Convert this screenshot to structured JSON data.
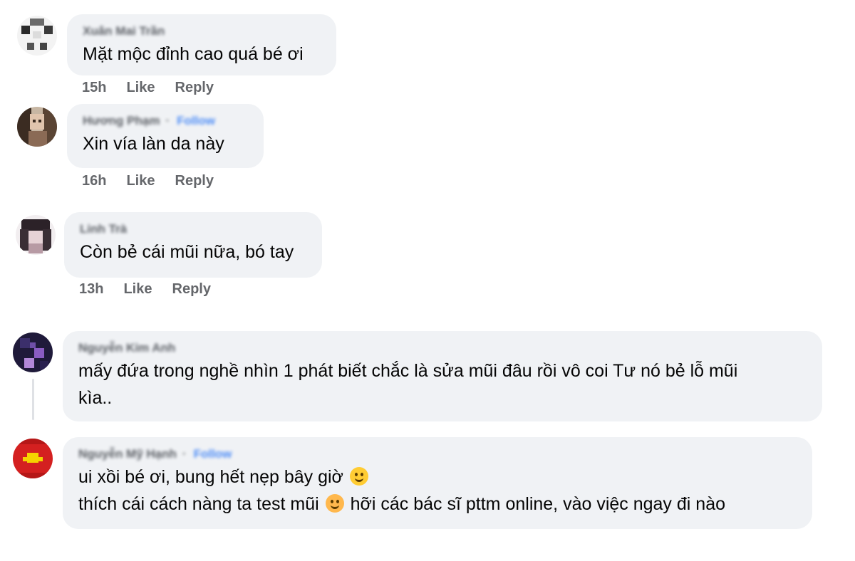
{
  "colors": {
    "bubble_bg": "#f0f2f5",
    "meta_text": "#65676b",
    "follow_blue": "#3b82f6"
  },
  "comments": [
    {
      "author": "Xuân Mai Trần",
      "follow": "",
      "text": "Mặt mộc đỉnh cao quá bé ơi",
      "time": "15h",
      "like": "Like",
      "reply": "Reply",
      "avatar_icon": "avatar-pixelated-icon"
    },
    {
      "author": "Hương Phạm",
      "follow": "Follow",
      "text": "Xin vía làn da này",
      "time": "16h",
      "like": "Like",
      "reply": "Reply",
      "avatar_icon": "avatar-pixelated-icon"
    },
    {
      "author": "Linh Trà",
      "follow": "",
      "text": "Còn bẻ cái mũi nữa, bó tay",
      "time": "13h",
      "like": "Like",
      "reply": "Reply",
      "avatar_icon": "avatar-pixelated-icon"
    },
    {
      "author": "Nguyễn Kim Anh",
      "follow": "",
      "text_line1": "mấy đứa trong nghề nhìn 1 phát biết chắc là sửa mũi đâu rồi vô coi Tư nó bẻ lỗ mũi",
      "text_line2": "kìa..",
      "avatar_icon": "avatar-pixelated-icon"
    },
    {
      "author": "Nguyễn Mỹ Hạnh",
      "follow": "Follow",
      "text_line1_a": "ui xồi bé ơi, bung hết nẹp bây giờ",
      "emoji1": "melting-face-emoji",
      "text_line2_a": "thích cái cách nàng ta test mũi",
      "emoji2": "rolling-laughing-emoji",
      "text_line2_b": "hỡi các bác sĩ pttm online, vào việc ngay đi nào",
      "avatar_icon": "avatar-pixelated-icon"
    }
  ]
}
